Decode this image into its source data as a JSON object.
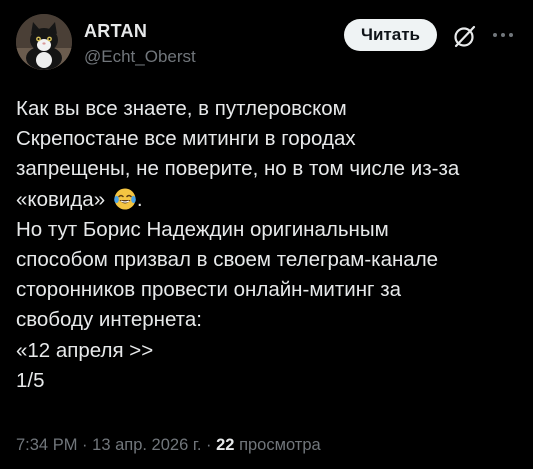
{
  "author": {
    "display_name": "ARTAN",
    "handle": "@Echt_Oberst"
  },
  "header": {
    "follow_label": "Читать",
    "grok_icon": "grok-slash-circle-icon",
    "more_icon": "more-horizontal-icon"
  },
  "tweet": {
    "lines": [
      "Как вы все знаете, в путлеровском",
      "Скрепостане все митинги в городах",
      "запрещены, не поверите, но в том числе из-за",
      "«ковида»",
      "Но тут Борис Надеждин оригинальным",
      "способом призвал в своем телеграм-канале",
      "сторонников провести онлайн-митинг за",
      "свободу интернета:",
      "«12 апреля >>",
      "1/5"
    ],
    "emoji": "face-with-tears-of-joy",
    "emoji_suffix": "."
  },
  "meta": {
    "time": "7:34 PM",
    "date": "13 апр. 2026 г.",
    "separator": "·",
    "views_count": "22",
    "views_label": "просмотра"
  },
  "colors": {
    "background": "#000000",
    "text_primary": "#e7e9ea",
    "text_secondary": "#71767b",
    "button_bg": "#eff3f4",
    "button_text": "#0f1419"
  }
}
